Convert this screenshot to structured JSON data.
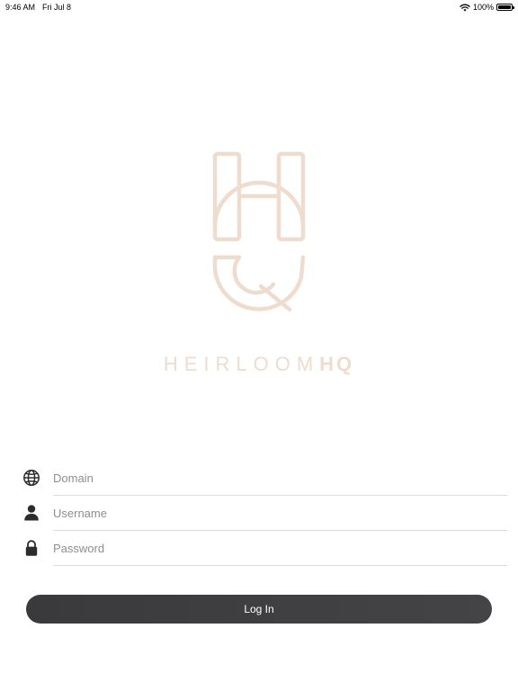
{
  "status_bar": {
    "time": "9:46 AM",
    "date": "Fri Jul 8",
    "battery_percent": "100%",
    "icons": [
      "wifi-icon",
      "battery-icon"
    ]
  },
  "brand": {
    "wordmark_light": "HEIRLOOM",
    "wordmark_bold": "HQ",
    "color": "#eedccf"
  },
  "form": {
    "domain": {
      "placeholder": "Domain",
      "value": "",
      "icon": "globe-icon"
    },
    "username": {
      "placeholder": "Username",
      "value": "",
      "icon": "person-icon"
    },
    "password": {
      "placeholder": "Password",
      "value": "",
      "icon": "lock-icon"
    }
  },
  "login_button": {
    "label": "Log In",
    "color": "#3a3a3c"
  }
}
